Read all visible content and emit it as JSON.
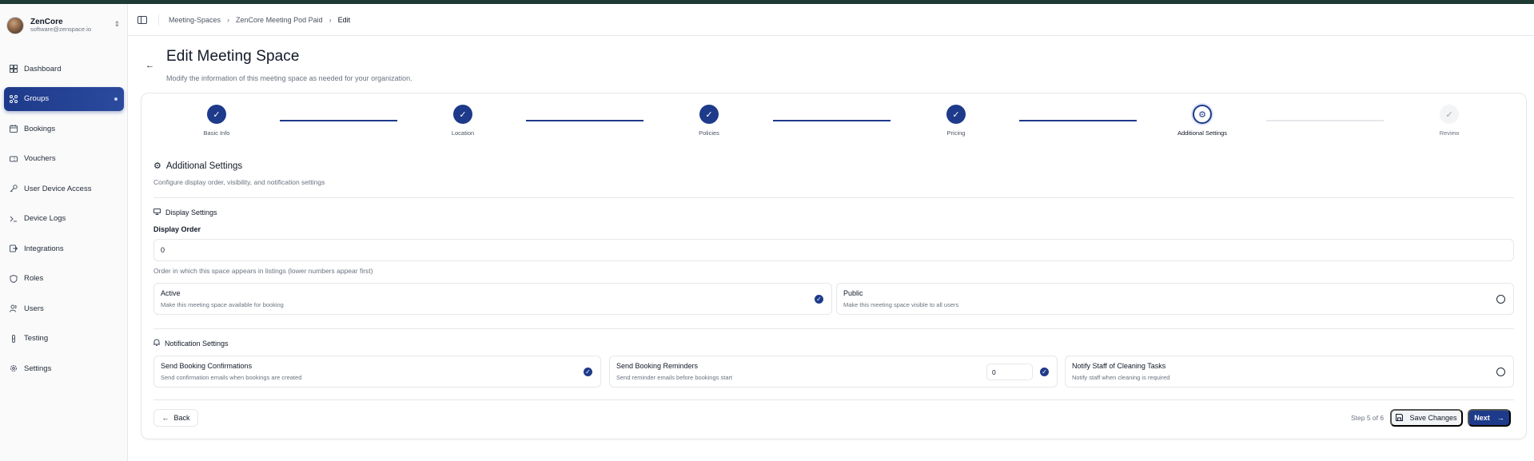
{
  "brand": {
    "name": "ZenCore",
    "email": "software@zenspace.io"
  },
  "sidebar": {
    "items": [
      {
        "label": "Dashboard",
        "icon": "dashboard-icon"
      },
      {
        "label": "Groups",
        "icon": "groups-icon",
        "active": true
      },
      {
        "label": "Bookings",
        "icon": "calendar-icon"
      },
      {
        "label": "Vouchers",
        "icon": "ticket-icon"
      },
      {
        "label": "User Device Access",
        "icon": "key-icon"
      },
      {
        "label": "Device Logs",
        "icon": "terminal-icon"
      },
      {
        "label": "Integrations",
        "icon": "plug-icon"
      },
      {
        "label": "Roles",
        "icon": "shield-icon"
      },
      {
        "label": "Users",
        "icon": "users-icon"
      },
      {
        "label": "Testing",
        "icon": "test-tube-icon"
      },
      {
        "label": "Settings",
        "icon": "gear-icon"
      }
    ]
  },
  "breadcrumb": [
    "Meeting-Spaces",
    "ZenCore Meeting Pod Paid",
    "Edit"
  ],
  "page": {
    "title": "Edit Meeting Space",
    "subtitle": "Modify the information of this meeting space as needed for your organization."
  },
  "stepper": {
    "steps": [
      {
        "label": "Basic Info",
        "state": "done"
      },
      {
        "label": "Location",
        "state": "done"
      },
      {
        "label": "Policies",
        "state": "done"
      },
      {
        "label": "Pricing",
        "state": "done"
      },
      {
        "label": "Additional Settings",
        "state": "current"
      },
      {
        "label": "Review",
        "state": "pending"
      }
    ]
  },
  "section": {
    "title": "Additional Settings",
    "description": "Configure display order, visibility, and notification settings"
  },
  "display": {
    "heading": "Display Settings",
    "order_label": "Display Order",
    "order_value": "0",
    "order_hint": "Order in which this space appears in listings (lower numbers appear first)",
    "active": {
      "title": "Active",
      "desc": "Make this meeting space available for booking",
      "checked": true
    },
    "public": {
      "title": "Public",
      "desc": "Make this meeting space visible to all users",
      "checked": false
    }
  },
  "notifications": {
    "heading": "Notification Settings",
    "confirmations": {
      "title": "Send Booking Confirmations",
      "desc": "Send confirmation emails when bookings are created",
      "checked": true
    },
    "reminders": {
      "title": "Send Booking Reminders",
      "desc": "Send reminder emails before bookings start",
      "value": "0",
      "checked": true
    },
    "cleaning": {
      "title": "Notify Staff of Cleaning Tasks",
      "desc": "Notify staff when cleaning is required",
      "checked": false
    }
  },
  "footer": {
    "back_label": "Back",
    "step_count": "Step 5 of 6",
    "save_label": "Save Changes",
    "next_label": "Next"
  },
  "colors": {
    "primary": "#1e3a8a",
    "topbar": "#1e3a33"
  }
}
